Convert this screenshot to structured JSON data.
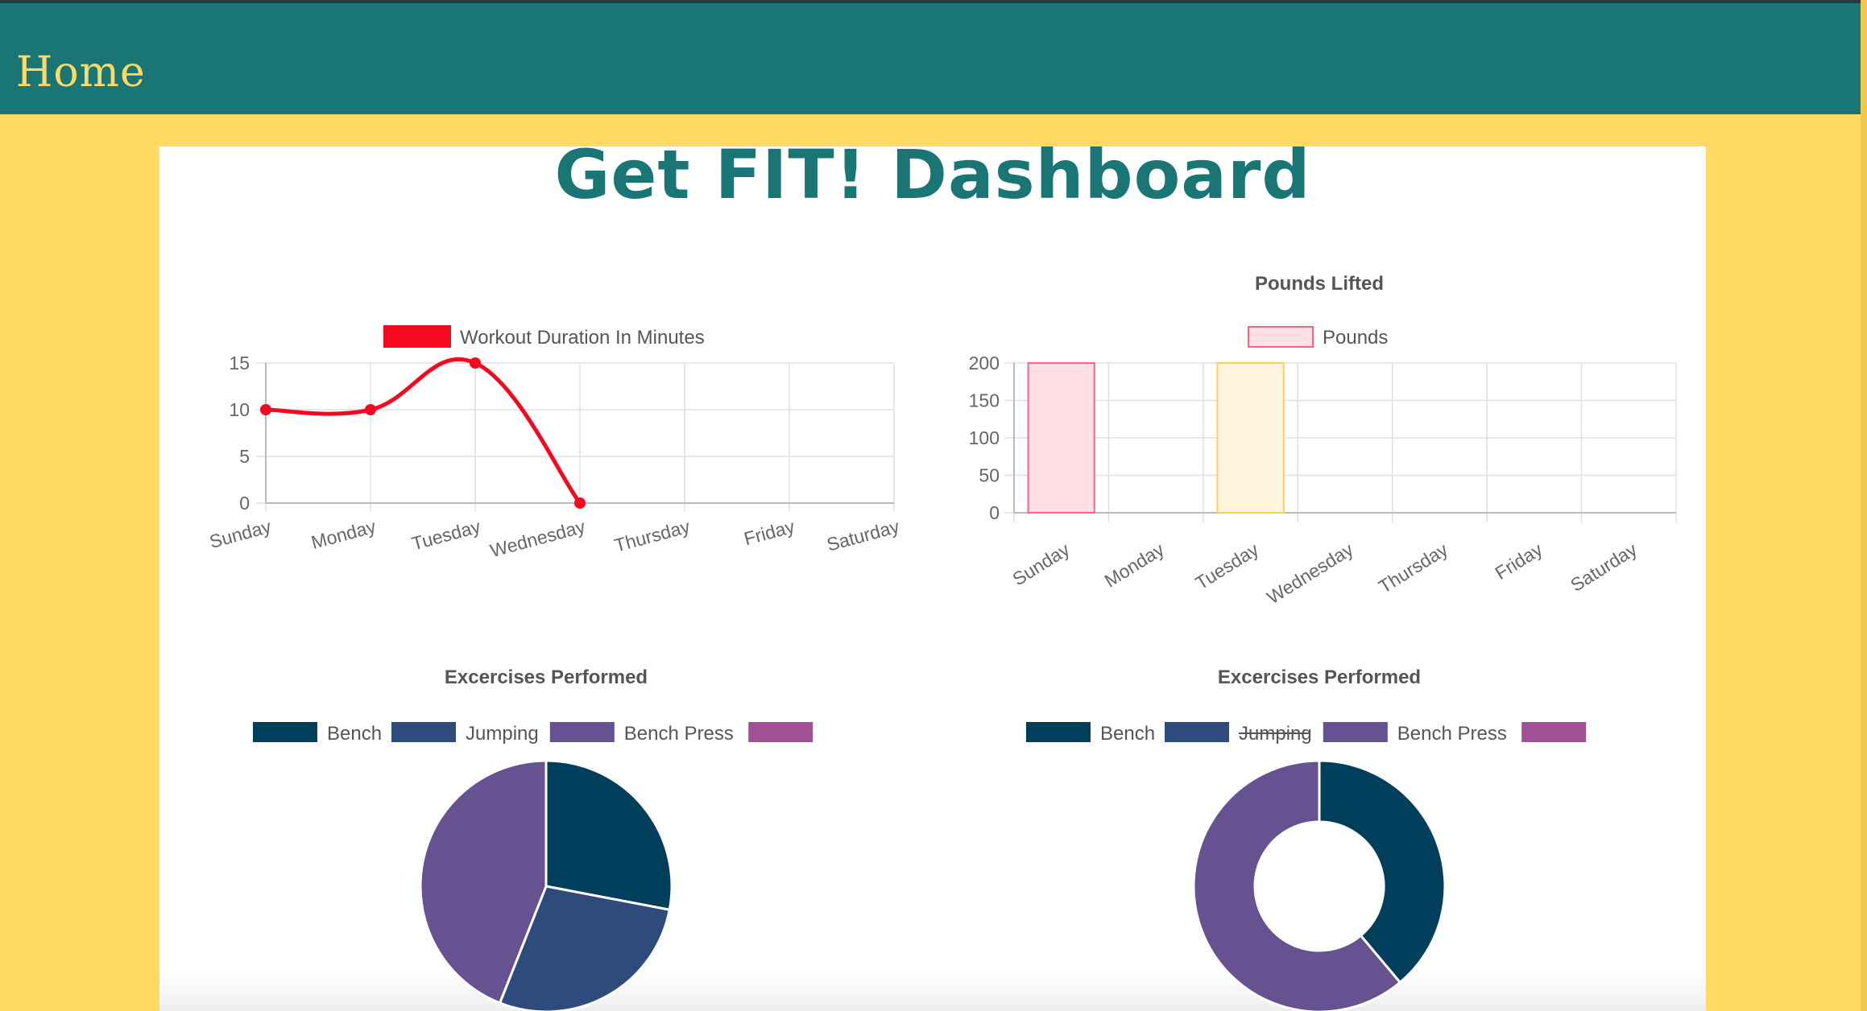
{
  "nav": {
    "home_label": "Home"
  },
  "page": {
    "title": "Get FIT! Dashboard"
  },
  "colors": {
    "nav_bg": "#1a7575",
    "page_bg": "#ffda63",
    "nav_text": "#ffd966",
    "title": "#1a7575"
  },
  "chart_data": [
    {
      "type": "line",
      "title": "",
      "categories": [
        "Sunday",
        "Monday",
        "Tuesday",
        "Wednesday",
        "Thursday",
        "Friday",
        "Saturday"
      ],
      "series": [
        {
          "name": "Workout Duration In Minutes",
          "values": [
            10,
            10,
            15,
            0,
            null,
            null,
            null
          ],
          "color": "#f5091f"
        }
      ],
      "ylim": [
        0,
        15
      ],
      "yticks": [
        0,
        5,
        10,
        15
      ],
      "legend": "top",
      "grid": true
    },
    {
      "type": "bar",
      "title": "Pounds Lifted",
      "categories": [
        "Sunday",
        "Monday",
        "Tuesday",
        "Wednesday",
        "Thursday",
        "Friday",
        "Saturday"
      ],
      "series": [
        {
          "name": "Pounds",
          "values": [
            200,
            0,
            200,
            0,
            0,
            0,
            0
          ],
          "fills": [
            "#ffe0e6",
            null,
            "#fff5e0",
            null,
            null,
            null,
            null
          ],
          "strokes": [
            "#ff6384",
            null,
            "#ffce56",
            null,
            null,
            null,
            null
          ]
        }
      ],
      "ylim": [
        0,
        200
      ],
      "yticks": [
        0,
        50,
        100,
        150,
        200
      ],
      "legend": "top",
      "grid": true
    },
    {
      "type": "pie",
      "title": "Excercises Performed",
      "labels": [
        "Bench",
        "Jumping",
        "Bench Press",
        ""
      ],
      "values": [
        28,
        28,
        44,
        0
      ],
      "colors": [
        "#003f5c",
        "#2f4b7c",
        "#665191",
        "#a05195"
      ],
      "hidden": [
        false,
        false,
        false,
        false
      ],
      "legend": "top"
    },
    {
      "type": "doughnut",
      "title": "Excercises Performed",
      "labels": [
        "Bench",
        "Jumping",
        "Bench Press",
        ""
      ],
      "values": [
        28,
        28,
        44,
        0
      ],
      "colors": [
        "#003f5c",
        "#2f4b7c",
        "#665191",
        "#a05195"
      ],
      "hidden": [
        false,
        true,
        false,
        false
      ],
      "legend": "top"
    }
  ]
}
